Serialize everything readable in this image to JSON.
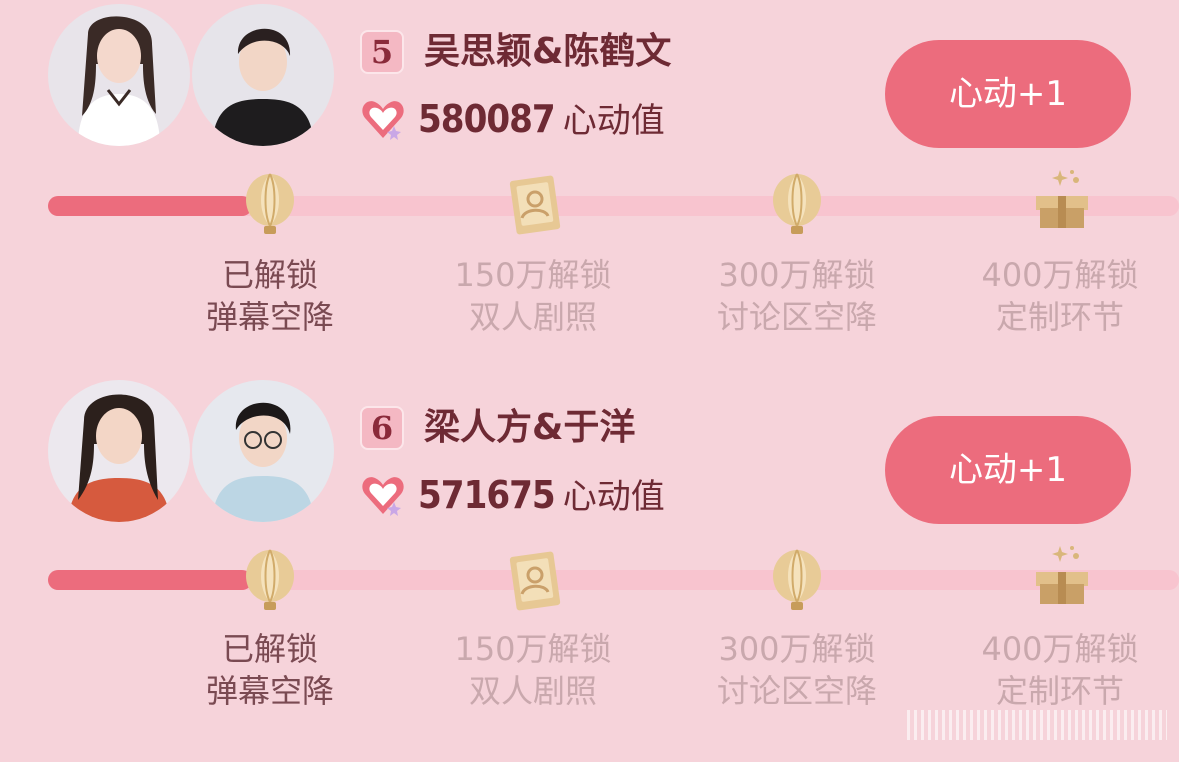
{
  "colors": {
    "accent": "#ec6c7d",
    "track": "#f8c4cf",
    "background": "#f6d3da",
    "gold": "#d9b67a",
    "text": "#6e2a34"
  },
  "cards": [
    {
      "rank": "5",
      "names": "吴思颖&陈鹤文",
      "score": "580087",
      "score_unit": "心动值",
      "button": "心动+1",
      "progress": 0.18,
      "milestones": [
        {
          "icon": "balloon-icon",
          "line1": "已解锁",
          "line2": "弹幕空降",
          "unlocked": true
        },
        {
          "icon": "photo-card-icon",
          "line1": "150万解锁",
          "line2": "双人剧照",
          "unlocked": false
        },
        {
          "icon": "balloon-icon",
          "line1": "300万解锁",
          "line2": "讨论区空降",
          "unlocked": false
        },
        {
          "icon": "gift-box-icon",
          "line1": "400万解锁",
          "line2": "定制环节",
          "unlocked": false
        }
      ]
    },
    {
      "rank": "6",
      "names": "梁人方&于洋",
      "score": "571675",
      "score_unit": "心动值",
      "button": "心动+1",
      "progress": 0.18,
      "milestones": [
        {
          "icon": "balloon-icon",
          "line1": "已解锁",
          "line2": "弹幕空降",
          "unlocked": true
        },
        {
          "icon": "photo-card-icon",
          "line1": "150万解锁",
          "line2": "双人剧照",
          "unlocked": false
        },
        {
          "icon": "balloon-icon",
          "line1": "300万解锁",
          "line2": "讨论区空降",
          "unlocked": false
        },
        {
          "icon": "gift-box-icon",
          "line1": "400万解锁",
          "line2": "定制环节",
          "unlocked": false
        }
      ]
    }
  ]
}
